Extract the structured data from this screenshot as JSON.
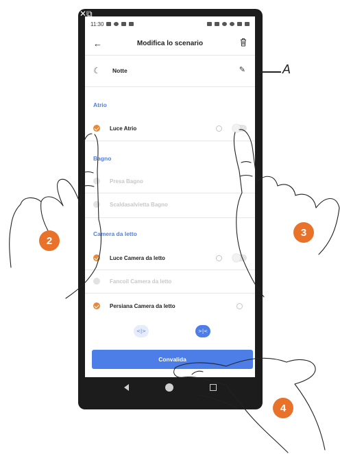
{
  "status_bar": {
    "time": "11:30"
  },
  "header": {
    "title": "Modifica lo scenario",
    "back_icon": "arrow-left-icon",
    "delete_icon": "trash-icon"
  },
  "scenario": {
    "name": "Notte",
    "icon": "moon-icon",
    "edit_icon": "pencil-icon"
  },
  "sections": [
    {
      "title": "Atrio",
      "items": [
        {
          "label": "Luce Atrio",
          "checked": true,
          "has_timer": true,
          "has_toggle": true
        }
      ]
    },
    {
      "title": "Bagno",
      "items": [
        {
          "label": "Presa Bagno",
          "checked": false
        },
        {
          "label": "Scaldasalvietta Bagno",
          "checked": false
        }
      ]
    },
    {
      "title": "Camera da letto",
      "items": [
        {
          "label": "Luce Camera da letto",
          "checked": true,
          "has_timer": true,
          "has_toggle": true
        },
        {
          "label": "Fancoil Camera da letto",
          "checked": false
        },
        {
          "label": "Persiana Camera da letto",
          "checked": true,
          "has_timer": true
        }
      ]
    }
  ],
  "shutter_buttons": {
    "open_label": "<|>",
    "close_label": ">|<"
  },
  "confirm_button": {
    "label": "Convalida"
  },
  "annotations": {
    "label_a": "A",
    "callouts": [
      "2",
      "3",
      "4"
    ]
  },
  "colors": {
    "accent_blue": "#4d7ee8",
    "check_orange": "#e8893a",
    "callout_orange": "#e8722a"
  }
}
